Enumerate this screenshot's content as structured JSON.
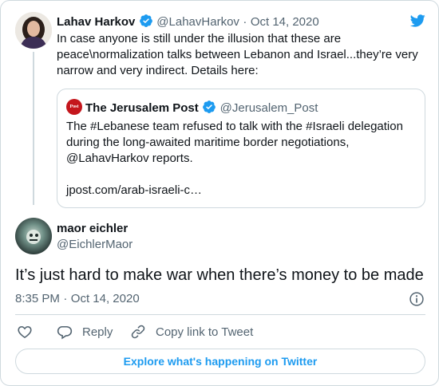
{
  "parent_tweet": {
    "author_name": "Lahav Harkov",
    "handle": "@LahavHarkov",
    "separator": "·",
    "date": "Oct 14, 2020",
    "text": "In case anyone is still under the illusion that these are peace\\normalization talks between Lebanon and Israel...they’re very narrow and very indirect. Details here:"
  },
  "quoted_tweet": {
    "author_name": "The Jerusalem Post",
    "handle": "@Jerusalem_Post",
    "text": "The #Lebanese team refused to talk with the #Israeli delegation during the long-awaited maritime border negotiations, @LahavHarkov reports.",
    "link": "jpost.com/arab-israeli-c…",
    "logo_text": "Post",
    "logo_color": "#c4161c"
  },
  "main_tweet": {
    "author_name": "maor eichler",
    "handle": "@EichlerMaor",
    "text": "It’s just hard to make war when there’s money to be made",
    "time": "8:35 PM",
    "separator": "·",
    "date": "Oct 14, 2020"
  },
  "actions": {
    "reply_label": "Reply",
    "copy_link_label": "Copy link to Tweet"
  },
  "explore_label": "Explore what's happening on Twitter",
  "icons": {
    "brand": "twitter-bird-icon",
    "verified": "verified-badge-icon",
    "info": "info-icon",
    "like": "heart-icon",
    "reply": "reply-bubble-icon",
    "copy_link": "link-icon"
  },
  "colors": {
    "brand_blue": "#1d9bf0",
    "text": "#0f1419",
    "muted": "#536471",
    "border": "#cfd9de"
  }
}
